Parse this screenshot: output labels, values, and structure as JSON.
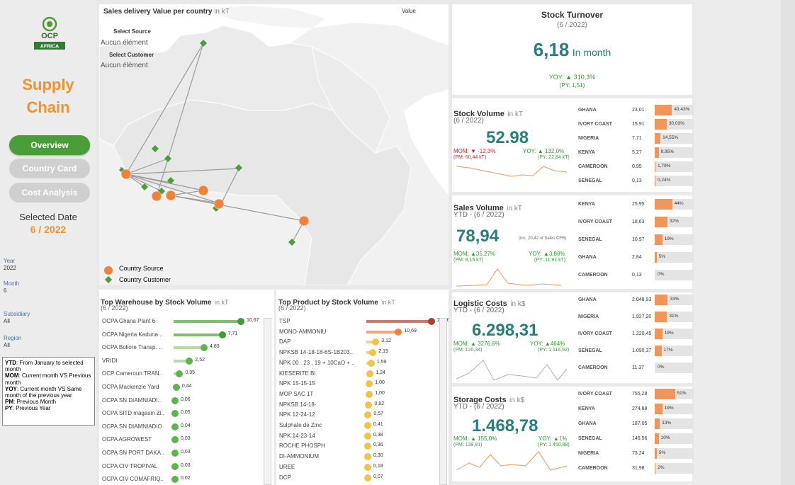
{
  "sidebar": {
    "title_line1": "Supply",
    "title_line2": "Chain",
    "nav": [
      "Overview",
      "Country Card",
      "Cost Analysis"
    ],
    "selected_date_label": "Selected Date",
    "selected_date_value": "6 / 2022",
    "filters": [
      {
        "key": "Year",
        "value": "2022"
      },
      {
        "key": "Month",
        "value": "6"
      },
      {
        "key": "Subsidiary",
        "value": "All"
      },
      {
        "key": "Region",
        "value": "All"
      }
    ],
    "glossary": [
      {
        "key": "YTD",
        "text": ": From January to selected month"
      },
      {
        "key": "MOM",
        "text": ": Current month VS Previous month"
      },
      {
        "key": "YOY",
        "text": ": Current month VS Same month of the previous year"
      },
      {
        "key": "PM",
        "text": ": Previous Month"
      },
      {
        "key": "PY",
        "text": ": Previous Year"
      }
    ],
    "logo_text": "OCP",
    "logo_sub": "AFRICA"
  },
  "map": {
    "title": "Sales delivery Value per country",
    "unit": "in kT",
    "value_label": "Value",
    "select_source_label": "Select Source",
    "select_source_value": "Aucun élément",
    "select_customer_label": "Select Customer",
    "select_customer_value": "Aucun élément",
    "legend_source": "Country Source",
    "legend_customer": "Country Customer",
    "colors": {
      "source": "#f0823a",
      "customer": "#4a9e37",
      "line": "#9a9a9a"
    }
  },
  "turnover": {
    "title": "Stock Turnover",
    "period": "(6 / 2022)",
    "value": "6,18",
    "value_unit": "In month",
    "yoy": "YOY: ▲ 310,3%",
    "py": "(PY: 1,51)"
  },
  "stock_volume": {
    "title": "Stock Volume",
    "unit": "in kT",
    "period": "(6 / 2022)",
    "value": "52.98",
    "mom": "MOM: ▼ -12,3%",
    "pm": "(PM: 60,44 kT)",
    "yoy": "YOY: ▲ 132,0%",
    "py": "(PY: 22,84 kT)",
    "bars": [
      {
        "country": "GHANA",
        "value": "23,01",
        "pct": "43,43%",
        "frac": 0.4343
      },
      {
        "country": "IVORY COAST",
        "value": "15,91",
        "pct": "30,03%",
        "frac": 0.3003
      },
      {
        "country": "NIGERIA",
        "value": "7,71",
        "pct": "14,55%",
        "frac": 0.1455
      },
      {
        "country": "KENYA",
        "value": "5,27",
        "pct": "9,95%",
        "frac": 0.0995
      },
      {
        "country": "CAMEROON",
        "value": "0,95",
        "pct": "1,79%",
        "frac": 0.0179
      },
      {
        "country": "SENEGAL",
        "value": "0,13",
        "pct": "0,24%",
        "frac": 0.0024
      }
    ]
  },
  "sales_volume": {
    "title": "Sales Volume",
    "unit": "in kT",
    "period": "YTD - (6 / 2022)",
    "value": "78,94",
    "note": "(inc. 20,42 of Sales CFR)",
    "mom": "MOM: ▲35,27%",
    "pm": "(PM: 9,15 kT)",
    "yoy": "YOY: ▲3,88%",
    "py": "(PY: 11,91 kT)",
    "bars": [
      {
        "country": "KENYA",
        "value": "25,95",
        "pct": "44%",
        "frac": 0.44
      },
      {
        "country": "IVORY COAST",
        "value": "18,63",
        "pct": "32%",
        "frac": 0.32
      },
      {
        "country": "SENEGAL",
        "value": "10,97",
        "pct": "19%",
        "frac": 0.19
      },
      {
        "country": "GHANA",
        "value": "2,84",
        "pct": "5%",
        "frac": 0.05
      },
      {
        "country": "CAMEROON",
        "value": "0,13",
        "pct": "0%",
        "frac": 0.0
      }
    ]
  },
  "logistic_costs": {
    "title": "Logistic Costs",
    "unit": "in k$",
    "period": "YTD - (6 / 2022)",
    "value": "6.298,31",
    "mom": "MOM: ▲ 3276,6%",
    "pm": "(PM: 120,34)",
    "yoy": "YOY: ▲464%",
    "py": "(PY: 1.116,92)",
    "bars": [
      {
        "country": "GHANA",
        "value": "2.048,93",
        "pct": "33%",
        "frac": 0.33
      },
      {
        "country": "NIGERIA",
        "value": "1.927,20",
        "pct": "31%",
        "frac": 0.31
      },
      {
        "country": "IVORY COAST",
        "value": "1.220,45",
        "pct": "19%",
        "frac": 0.19
      },
      {
        "country": "SENEGAL",
        "value": "1.090,37",
        "pct": "17%",
        "frac": 0.17
      },
      {
        "country": "CAMEROON",
        "value": "11,37",
        "pct": "0%",
        "frac": 0.0
      }
    ]
  },
  "storage_costs": {
    "title": "Storage Costs",
    "unit": "in k$",
    "period": "YTD - (6 / 2022)",
    "value": "1.468,78",
    "mom": "MOM: ▲ 155,0%",
    "pm": "(PM: 139,81)",
    "yoy": "YOY: ▲1%",
    "py": "(PY: 1.450,88)",
    "bars": [
      {
        "country": "IVORY COAST",
        "value": "755,28",
        "pct": "51%",
        "frac": 0.51
      },
      {
        "country": "KENYA",
        "value": "274,68",
        "pct": "19%",
        "frac": 0.19
      },
      {
        "country": "GHANA",
        "value": "187,05",
        "pct": "13%",
        "frac": 0.13
      },
      {
        "country": "SENEGAL",
        "value": "146,56",
        "pct": "10%",
        "frac": 0.1
      },
      {
        "country": "NIGERIA",
        "value": "73,24",
        "pct": "5%",
        "frac": 0.05
      },
      {
        "country": "CAMEROON",
        "value": "31,98",
        "pct": "2%",
        "frac": 0.02
      }
    ]
  },
  "warehouse": {
    "title": "Top Warehouse by Stock Volume",
    "unit": "in kT",
    "period": "(6 / 2022)",
    "rows": [
      {
        "name": "OCPA Ghana Plant 6",
        "value": 10.67,
        "label": "10,67"
      },
      {
        "name": "OCPA Nigeria Kaduna ..",
        "value": 7.71,
        "label": "7,71"
      },
      {
        "name": "OCPA Bollore Transp. ..",
        "value": 4.83,
        "label": "4,83"
      },
      {
        "name": "VRIDI",
        "value": 2.52,
        "label": "2,52"
      },
      {
        "name": "OCP Cameroun TRAN..",
        "value": 0.95,
        "label": "0,95"
      },
      {
        "name": "OCPA Mackenzie Yard",
        "value": 0.44,
        "label": "0,44"
      },
      {
        "name": "OCPA SN DIAMNIADI..",
        "value": 0.06,
        "label": "0,06"
      },
      {
        "name": "OCPA SITD magasin Zi..",
        "value": 0.05,
        "label": "0,05"
      },
      {
        "name": "OCPA SN DIAMNIADIO",
        "value": 0.04,
        "label": "0,04"
      },
      {
        "name": "OCPA AGROWEST",
        "value": 0.03,
        "label": "0,03"
      },
      {
        "name": "OCPA SN PORT DAKA..",
        "value": 0.03,
        "label": "0,03"
      },
      {
        "name": "OCPA CIV TROPIVAL",
        "value": 0.03,
        "label": "0,03"
      },
      {
        "name": "OCPA CIV COMAFRIQ..",
        "value": 0.02,
        "label": "0,02"
      }
    ]
  },
  "product": {
    "title": "Top Product by Stock Volume",
    "unit": "in kT",
    "period": "(6 / 2022)",
    "rows": [
      {
        "name": "TSP",
        "value": 21.66,
        "label": "21,66"
      },
      {
        "name": "MONO-AMMONIU",
        "value": 10.69,
        "label": "10,69"
      },
      {
        "name": "DAP",
        "value": 3.12,
        "label": "3,12"
      },
      {
        "name": "NPKSB 14-18-18-6S-1B203..",
        "value": 2.19,
        "label": "2,19"
      },
      {
        "name": "NPK 00 . 23 . 19 + 10CaO + ..",
        "value": 1.59,
        "label": "1,59"
      },
      {
        "name": "KIESERITE BI",
        "value": 1.24,
        "label": "1,24"
      },
      {
        "name": "NPK 15-15-15",
        "value": 1.0,
        "label": "1,00"
      },
      {
        "name": "MOP SAC 1T",
        "value": 1.0,
        "label": "1,00"
      },
      {
        "name": "NPKSB 14-18-",
        "value": 0.82,
        "label": "0,82"
      },
      {
        "name": "NPK 12-24-12",
        "value": 0.57,
        "label": "0,57"
      },
      {
        "name": "Sulphate de Zinc",
        "value": 0.41,
        "label": "0,41"
      },
      {
        "name": "NPK 14-23-14",
        "value": 0.38,
        "label": "0,38"
      },
      {
        "name": "ROCHE PHOSPH",
        "value": 0.36,
        "label": "0,36"
      },
      {
        "name": "DI-AMMONIUM",
        "value": 0.3,
        "label": "0,30"
      },
      {
        "name": "UREE",
        "value": 0.18,
        "label": "0,18"
      },
      {
        "name": "DCP",
        "value": 0.07,
        "label": "0,07"
      }
    ]
  }
}
